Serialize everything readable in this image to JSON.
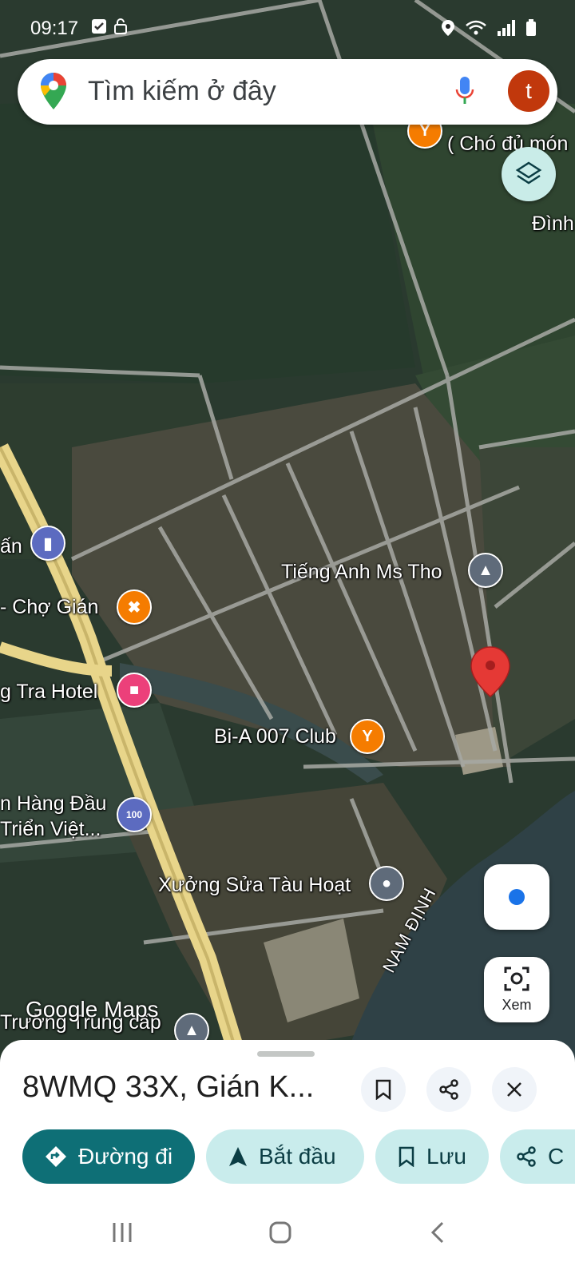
{
  "status_bar": {
    "time": "09:17"
  },
  "search": {
    "placeholder": "Tìm kiếm ở đây",
    "avatar_letter": "t"
  },
  "map": {
    "labels": {
      "cho_du_mon": "( Chó đủ món",
      "dinh": "Đình",
      "ms_tho": "Tiếng Anh Ms Tho",
      "an": "ấn",
      "cho_gian": "- Chợ Gián",
      "tra_hotel": "g Tra Hotel",
      "bia_club": "Bi-A 007 Club",
      "hang_dau": "n Hàng Đầu",
      "trien_viet": "Triển Việt...",
      "xuong_sua": "Xưởng Sửa Tàu Hoạt",
      "nam_dinh": "NAM ĐỊNH",
      "truong": "Trường Trung cấp"
    },
    "watermark": "Google Maps",
    "lens_label": "Xem",
    "gas_badge": "100"
  },
  "place": {
    "title": "8WMQ 33X, Gián K...",
    "actions": [
      "Đường đi",
      "Bắt đầu",
      "Lưu",
      "C"
    ]
  },
  "colors": {
    "primary": "#0e6f76",
    "chip": "#c9ecec",
    "pin": "#e53935",
    "avatar": "#c1380c"
  }
}
